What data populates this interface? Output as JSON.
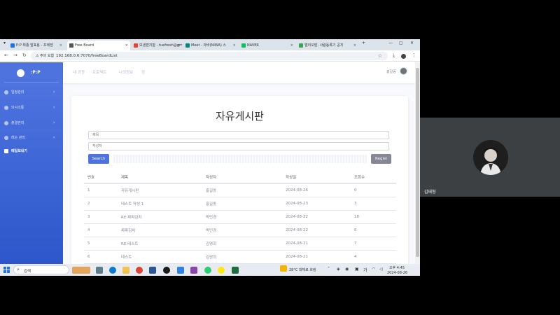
{
  "browser": {
    "tabs": [
      {
        "label": "P:P 최종 발표용 - 프레젠",
        "fav": "#1a73e8",
        "active": false
      },
      {
        "label": "Free Board",
        "fav": "#555555",
        "active": true
      },
      {
        "label": "보낸편지함 - tuefresh@gm",
        "fav": "#ea4335",
        "active": false
      },
      {
        "label": "Meet - 자바(NIWA) 스",
        "fav": "#00897b",
        "active": false
      },
      {
        "label": "NAVER",
        "fav": "#03c75a",
        "active": false
      },
      {
        "label": "엘리오발, 사람동록기 공지",
        "fav": "#34a853",
        "active": false
      }
    ],
    "new_tab": "+",
    "security_label": "주의 요함",
    "url": "192.168.0.6:7070/freeBoardList"
  },
  "sidebar": {
    "brand": ":P:P",
    "items": [
      {
        "label": "일정관리",
        "chevron": "›"
      },
      {
        "label": "의사소통",
        "chevron": "›"
      },
      {
        "label": "출결관리",
        "chevron": "›"
      },
      {
        "label": "레슨 관리",
        "chevron": "›"
      }
    ],
    "extra_item": "메일보내기"
  },
  "topnav": {
    "links": [
      "내 과정",
      "프로젝트",
      "나의정보",
      "정"
    ],
    "user_name": "홍길동"
  },
  "board": {
    "title": "자유게시판",
    "title_placeholder": "제목",
    "author_placeholder": "작성자",
    "search_label": "Search",
    "regist_label": "Regist",
    "headers": [
      "번호",
      "제목",
      "작성자",
      "작성일",
      "조회수"
    ],
    "rows": [
      [
        "1",
        "자유게시판",
        "홍길동",
        "2024-08-26",
        "0"
      ],
      [
        "2",
        "테스트 작성 1",
        "홍길동",
        "2024-08-23",
        "3"
      ],
      [
        "3",
        "RE:짜짜김치",
        "박민경",
        "2024-08-22",
        "18"
      ],
      [
        "4",
        "짜짜김치",
        "박민경",
        "2024-08-22",
        "6"
      ],
      [
        "5",
        "RE:테스트",
        "김영희",
        "2024-08-21",
        "7"
      ],
      [
        "6",
        "테스트",
        "김영희",
        "2024-08-21",
        "4"
      ]
    ]
  },
  "taskbar": {
    "search_placeholder": "검색",
    "weather": "28°C 대체로 흐림",
    "time": "오후 4:45",
    "date": "2024-08-26"
  },
  "meeting": {
    "participant_name": "김태형"
  }
}
